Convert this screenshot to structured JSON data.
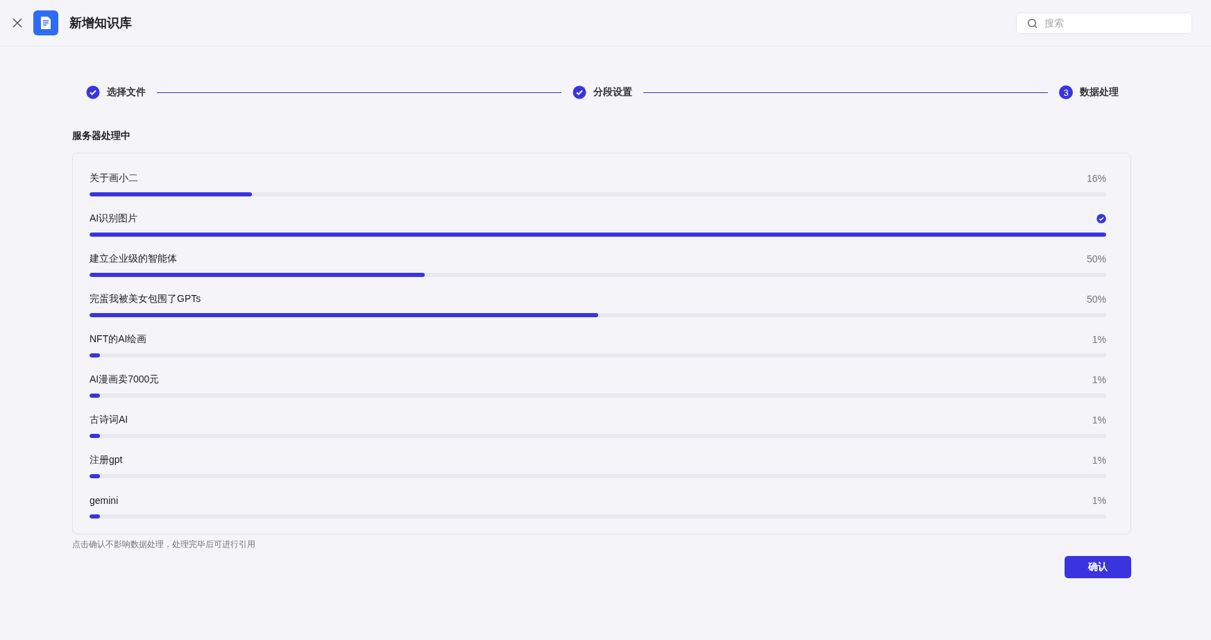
{
  "header": {
    "title": "新增知识库",
    "search": {
      "placeholder": "搜索"
    }
  },
  "steps": [
    {
      "label": "选择文件",
      "done": true
    },
    {
      "label": "分段设置",
      "done": true
    },
    {
      "label": "数据处理",
      "done": false,
      "number": "3"
    }
  ],
  "section_title": "服务器处理中",
  "items": [
    {
      "name": "关于画小二",
      "level": 0.16,
      "done": false,
      "reading": "16%"
    },
    {
      "name": "AI识别图片",
      "level": 1,
      "done": true
    },
    {
      "name": "建立企业级的智能体",
      "level": 0.33,
      "done": false,
      "reading": "50%"
    },
    {
      "name": "完蛋我被美女包围了GPTs",
      "level": 0.5,
      "done": false,
      "reading": "50%"
    },
    {
      "name": "NFT的AI绘画",
      "level": 0.01,
      "done": false,
      "reading": "1%"
    },
    {
      "name": "AI漫画卖7000元",
      "level": 0.01,
      "done": false,
      "reading": "1%"
    },
    {
      "name": "古诗词AI",
      "level": 0.01,
      "done": false,
      "reading": "1%"
    },
    {
      "name": "注册gpt",
      "level": 0.01,
      "done": false,
      "reading": "1%"
    },
    {
      "name": "gemini",
      "level": 0.01,
      "done": false,
      "reading": "1%"
    }
  ],
  "note": "点击确认不影响数据处理，处理完毕后可进行引用",
  "confirm_button": "确认"
}
